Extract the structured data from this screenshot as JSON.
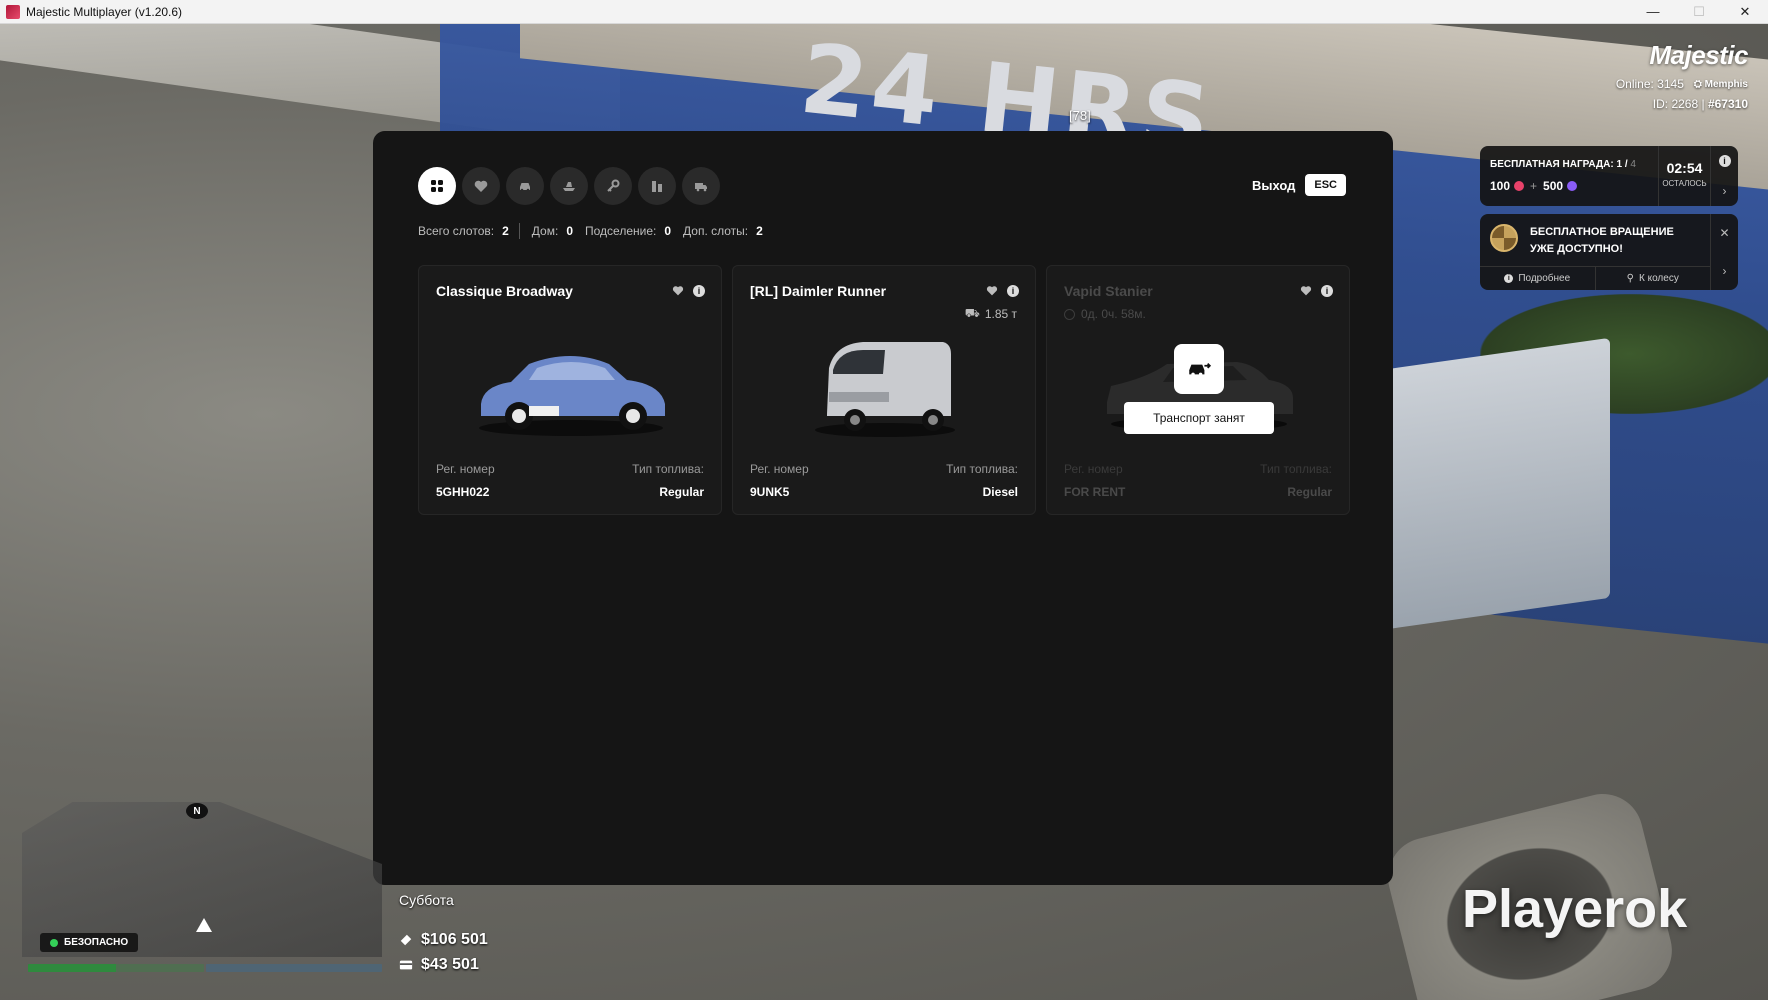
{
  "window": {
    "title": "Majestic Multiplayer (v1.20.6)",
    "controls": [
      "—",
      "☐",
      "✕"
    ]
  },
  "background": {
    "kiosk_text": "24 HRS",
    "ped_label": "[78]"
  },
  "hud": {
    "brand": "Majestic",
    "online_label": "Online: 3145",
    "server": "Memphis",
    "id_text": "ID: 2268 |",
    "id_hash": "#67310"
  },
  "notifications": {
    "reward": {
      "title": "БЕСПЛАТНАЯ НАГРАДА: 1 /",
      "title_total": "4",
      "value_a": "100",
      "plus": "+",
      "value_b": "500",
      "time": "02:54",
      "time_label": "ОСТАЛОСЬ"
    },
    "spin": {
      "title": "БЕСПЛАТНОЕ ВРАЩЕНИЕ УЖЕ ДОСТУПНО!",
      "details": "Подробнее",
      "to_wheel": "К колесу"
    }
  },
  "garage": {
    "tabs": [
      {
        "name": "all",
        "icon": "grid-icon",
        "active": true
      },
      {
        "name": "favorites",
        "icon": "heart-icon"
      },
      {
        "name": "cars",
        "icon": "car-icon"
      },
      {
        "name": "boats",
        "icon": "boat-icon"
      },
      {
        "name": "keys",
        "icon": "key-icon"
      },
      {
        "name": "business",
        "icon": "building-icon"
      },
      {
        "name": "trucks",
        "icon": "truck-icon"
      }
    ],
    "exit_label": "Выход",
    "esc_label": "ESC",
    "slots": {
      "total_label": "Всего слотов:",
      "total_value": "2",
      "house_label": "Дом:",
      "house_value": "0",
      "sub_label": "Подселение:",
      "sub_value": "0",
      "extra_label": "Доп. слоты:",
      "extra_value": "2"
    },
    "reg_label": "Рег. номер",
    "fuel_label": "Тип топлива:",
    "vehicles": [
      {
        "name": "Classique Broadway",
        "plate": "5GHH022",
        "fuel": "Regular",
        "color": "#6a86c8"
      },
      {
        "name": "[RL] Daimler Runner",
        "plate": "9UNK5",
        "fuel": "Diesel",
        "weight": "1.85 т",
        "color": "#c9cbcf"
      },
      {
        "name": "Vapid Stanier",
        "plate": "FOR RENT",
        "fuel": "Regular",
        "rent_time": "0д. 0ч. 58м.",
        "busy_label": "Транспорт занят",
        "color": "#2b2b2b"
      }
    ]
  },
  "status": {
    "zone": "БЕЗОПАСНО",
    "minimap_north": "N",
    "day": "Суббота",
    "cash": "$106 501",
    "bank": "$43 501",
    "bars": [
      {
        "name": "health",
        "fill": 0.5,
        "color": "#2f8a3e"
      },
      {
        "name": "armor",
        "fill": 0.0,
        "color": "#2d6ea8"
      }
    ]
  },
  "watermark": "Playerok"
}
